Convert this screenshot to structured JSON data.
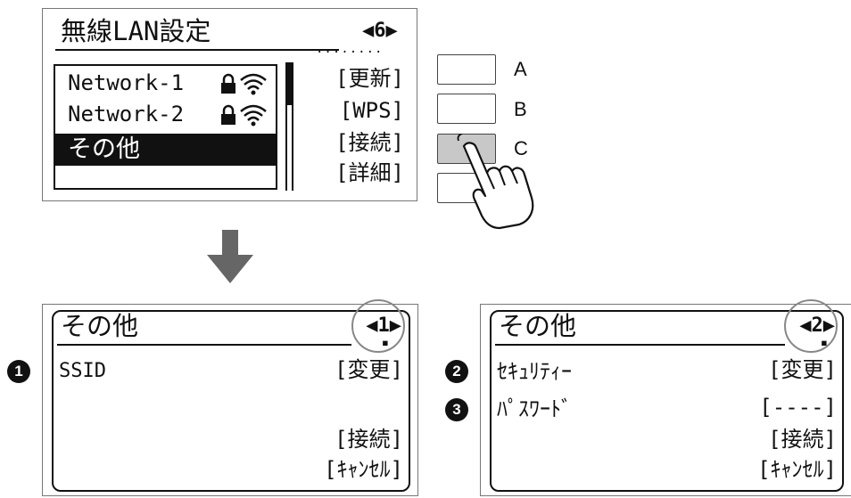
{
  "top_panel": {
    "title": "無線LAN設定",
    "page": "◀6▶",
    "page_dots": "........",
    "networks": [
      {
        "name": "Network-1"
      },
      {
        "name": "Network-2"
      }
    ],
    "selected_item": "その他",
    "menu": [
      "[更新]",
      "[WPS]",
      "[接続]",
      "[詳細]"
    ]
  },
  "buttons": {
    "a": "A",
    "b": "B",
    "c": "C"
  },
  "panel_other_1": {
    "title": "その他",
    "page": "◀1▶",
    "marker": "1",
    "rows": [
      {
        "label": "SSID",
        "action": "[変更]"
      }
    ],
    "connect": "[接続]",
    "cancel": "[ｷｬﾝｾﾙ]"
  },
  "panel_other_2": {
    "title": "その他",
    "page": "◀2▶",
    "markers": [
      "2",
      "3"
    ],
    "rows": [
      {
        "label": "ｾｷｭﾘﾃｨｰ",
        "action": "[変更]"
      },
      {
        "label": "ﾊﾟｽﾜｰﾄﾞ",
        "action": "[----]"
      }
    ],
    "connect": "[接続]",
    "cancel": "[ｷｬﾝｾﾙ]"
  },
  "colors": {
    "lcd_border": "#777777",
    "selected_bg": "#111111",
    "pressed_button": "#c8c8c8",
    "arrow": "#666666"
  },
  "icons": [
    "lock-icon",
    "wifi-icon",
    "pointing-hand-icon",
    "down-arrow-icon"
  ]
}
